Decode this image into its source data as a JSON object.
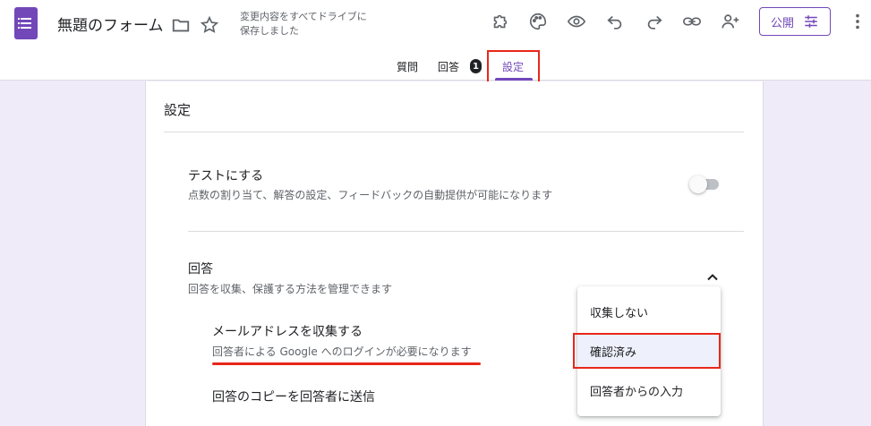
{
  "header": {
    "form_title": "無題のフォーム",
    "save_status_line1": "変更内容をすべてドライブに",
    "save_status_line2": "保存しました",
    "publish_label": "公開"
  },
  "tabs": [
    {
      "label": "質問"
    },
    {
      "label": "回答",
      "badge": "1"
    },
    {
      "label": "設定",
      "active": true
    }
  ],
  "settings": {
    "title": "設定",
    "quiz": {
      "title": "テストにする",
      "description": "点数の割り当て、解答の設定、フィードバックの自動提供が可能になります",
      "enabled": false
    },
    "responses": {
      "title": "回答",
      "description": "回答を収集、保護する方法を管理できます",
      "collect_email": {
        "title": "メールアドレスを収集する",
        "description": "回答者による Google へのログインが必要になります"
      },
      "send_copy": {
        "title": "回答のコピーを回答者に送信"
      }
    }
  },
  "email_menu": {
    "options": [
      "収集しない",
      "確認済み",
      "回答者からの入力"
    ],
    "selected": "確認済み"
  },
  "colors": {
    "accent": "#7248b9",
    "background": "#f0ebf8",
    "highlight": "#e8271a"
  }
}
